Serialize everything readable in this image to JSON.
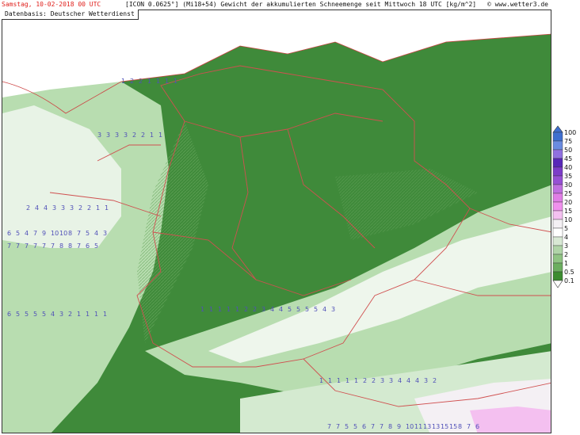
{
  "header": {
    "run_info": "Samstag, 10-02-2018  00 UTC",
    "title": "[ICON 0.0625°] (Mi18+54)  Gewicht der akkumulierten Schneemenge seit Mittwoch 18 UTC [kg/m^2]",
    "credit": "© www.wetter3.de"
  },
  "source_label": "Datenbasis: Deutscher Wetterdienst",
  "legend": {
    "levels": [
      "100",
      "75",
      "50",
      "45",
      "40",
      "35",
      "30",
      "25",
      "20",
      "15",
      "10",
      "5",
      "4",
      "3",
      "2",
      "1",
      "0.5",
      "0.1"
    ],
    "colors": [
      "#3f6fd0",
      "#6a8be0",
      "#9070e0",
      "#5828b8",
      "#7c3cc8",
      "#9650d4",
      "#c070e0",
      "#e07ee6",
      "#f090ee",
      "#f4c0f0",
      "#f4f0f4",
      "#ffffff",
      "#d8e8d4",
      "#b0d4a8",
      "#90c484",
      "#6cae60",
      "#3c8c30",
      "#ffffff"
    ]
  },
  "colors": {
    "land": "#3f8a3a",
    "sea_shading": "#e8eee8",
    "borders": "#d05050",
    "grid_numbers": "#5050b8",
    "light_snow": "#9fcf95",
    "heavy_snow": "#ffffff"
  },
  "grid_values": {
    "row_y_labels": [
      "1 2 2 1 1 1 1",
      "3 3 3 3 2 2 1 1",
      "2 4 4 3 3 3 2 2 1 1",
      "6 5 4 7 9 10 10 8 7 5 4 3",
      "7 7 7 7 7 7 8 8 7 6 5",
      "6 5 5 5 5 4 3 2 1 1 1 1",
      "1 1 1 1 1 2 2 3 4 4 5 5 5 5 4 3",
      "1 1 1 1 1 2 2 3 3 4 4 4 3 2",
      "7 7 5 5 6 7 7 8 9 10 11 13 13 15 15 8 7 6"
    ]
  }
}
